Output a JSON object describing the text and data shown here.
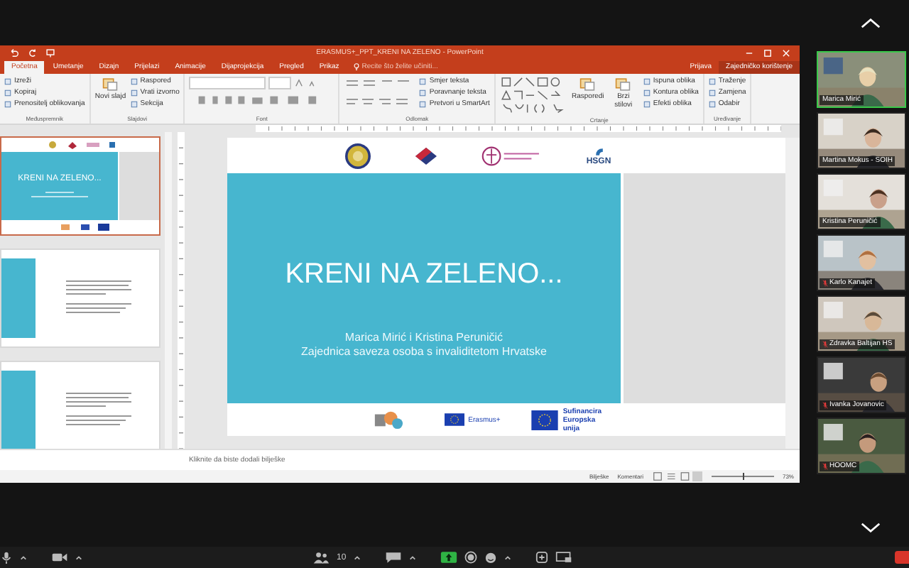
{
  "window": {
    "title": "ERASMUS+_PPT_KRENI NA ZELENO - PowerPoint"
  },
  "ribbon_tabs": [
    {
      "label": "Početna",
      "selected": true
    },
    {
      "label": "Umetanje",
      "selected": false
    },
    {
      "label": "Dizajn",
      "selected": false
    },
    {
      "label": "Prijelazi",
      "selected": false
    },
    {
      "label": "Animacije",
      "selected": false
    },
    {
      "label": "Dijaprojekcija",
      "selected": false
    },
    {
      "label": "Pregled",
      "selected": false
    },
    {
      "label": "Prikaz",
      "selected": false
    }
  ],
  "tell_me": {
    "placeholder": "Recite što želite učiniti..."
  },
  "account": {
    "sign_in": "Prijava",
    "share": "Zajedničko korištenje"
  },
  "ribbon_groups": [
    {
      "kind": "plain",
      "label": "Međuspremnik",
      "items": [
        "Izreži",
        "Kopiraj",
        "Prenositelj oblikovanja"
      ]
    },
    {
      "kind": "plain",
      "label": "Slajdovi",
      "big": [
        "Novi slajd"
      ],
      "items": [
        "Raspored",
        "Vrati izvorno",
        "Sekcija"
      ]
    },
    {
      "kind": "font",
      "label": "Font"
    },
    {
      "kind": "paragraph",
      "label": "Odlomak",
      "items": [
        "Smjer teksta",
        "Poravnanje teksta",
        "Pretvori u SmartArt"
      ]
    },
    {
      "kind": "drawing",
      "label": "Crtanje",
      "big": [
        "Rasporedi",
        "Brzi stilovi"
      ],
      "items": [
        "Ispuna oblika",
        "Kontura oblika",
        "Efekti oblika"
      ]
    },
    {
      "kind": "plain",
      "label": "Uređivanje",
      "items": [
        "Traženje",
        "Zamjena",
        "Odabir"
      ]
    }
  ],
  "thumbnails": [
    {
      "selected": true,
      "title": "KRENI NA ZELENO..."
    },
    {
      "selected": false
    },
    {
      "selected": false
    }
  ],
  "slide": {
    "title": "KRENI NA ZELENO...",
    "subtitle": [
      "Marica Mirić i Kristina Peruničić",
      "Zajednica saveza osoba s invaliditetom Hrvatske"
    ],
    "logo_text": "HSGN",
    "bottom_logos": [
      "Erasmus+",
      "Sufinancira Europska unija"
    ]
  },
  "notes": {
    "placeholder": "Kliknite da biste dodali bilješke"
  },
  "status_bar": {
    "notes": "Bilješke",
    "comments": "Komentari",
    "zoom": "73%",
    "zoom_slider": {
      "level": 0.5
    }
  },
  "participants": [
    {
      "name": "Marica Mirić",
      "muted": false,
      "speaking": true
    },
    {
      "name": "Martina Mokus - SOIH",
      "muted": false,
      "speaking": false
    },
    {
      "name": "Kristina Peruničić",
      "muted": false,
      "speaking": false
    },
    {
      "name": "Karlo Kanajet",
      "muted": true,
      "speaking": false
    },
    {
      "name": "Zdravka Baltijan HS",
      "muted": true,
      "speaking": false
    },
    {
      "name": "Ivanka Jovanovic",
      "muted": true,
      "speaking": false
    },
    {
      "name": "HOOMC",
      "muted": true,
      "speaking": false
    }
  ],
  "toolbar": {
    "participant_count": "10"
  }
}
